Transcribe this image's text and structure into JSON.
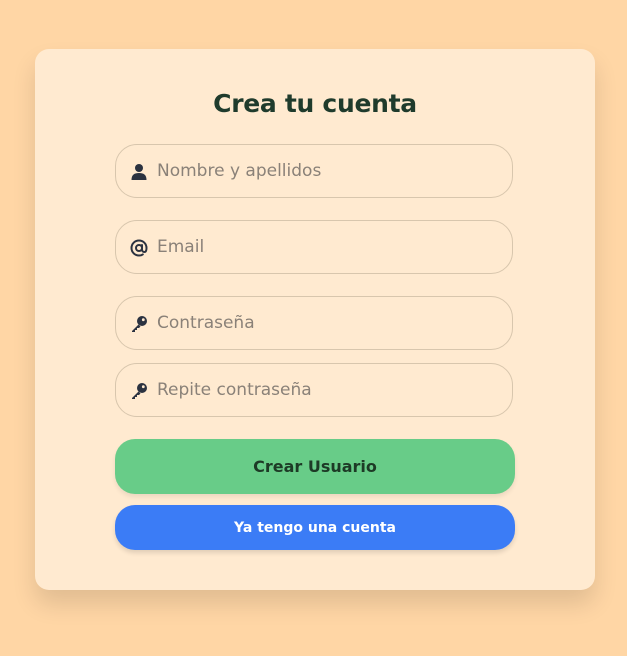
{
  "form": {
    "title": "Crea tu cuenta",
    "fields": [
      {
        "name": "full-name",
        "placeholder": "Nombre y apellidos",
        "icon": "user-icon",
        "value": ""
      },
      {
        "name": "email",
        "placeholder": "Email",
        "icon": "at-icon",
        "value": ""
      },
      {
        "name": "password",
        "placeholder": "Contraseña",
        "icon": "key-icon",
        "value": ""
      },
      {
        "name": "repeat-password",
        "placeholder": "Repite contraseña",
        "icon": "key-icon",
        "value": ""
      }
    ],
    "create_button_label": "Crear Usuario",
    "login_button_label": "Ya tengo una cuenta"
  },
  "colors": {
    "background": "#ffd6a5",
    "card": "#ffead0",
    "create_button": "#68cc88",
    "login_button": "#3b7cf6",
    "title": "#1f3b2c"
  }
}
